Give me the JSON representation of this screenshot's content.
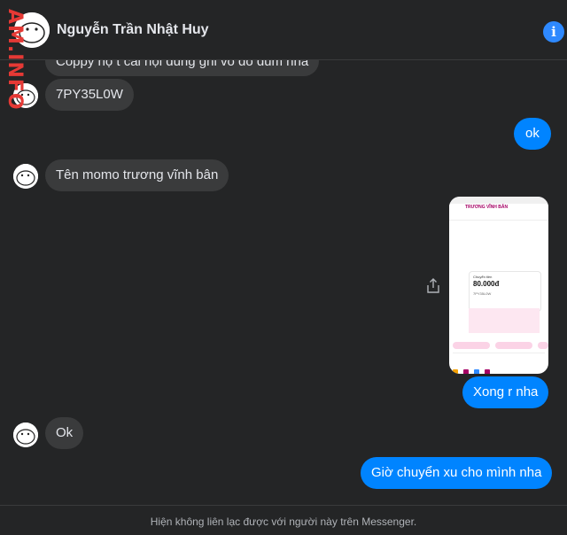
{
  "header": {
    "contact_name": "Nguyễn Trần Nhật Huy",
    "watermark": "AM.INFO"
  },
  "icons": {
    "info": "info-icon",
    "share": "share-icon",
    "avatar": "doodle-avatar-icon"
  },
  "colors": {
    "outgoing_bubble": "#0084ff",
    "incoming_bubble": "#3a3b3c",
    "background": "#242526",
    "info_button": "#2e89ff",
    "watermark": "#e53935"
  },
  "messages": [
    {
      "direction": "in",
      "text": "Coppy họ t cái nội dung ghi vô đó dùm nha"
    },
    {
      "direction": "in",
      "text": "7PY35L0W"
    },
    {
      "direction": "out",
      "text": "ok"
    },
    {
      "direction": "in",
      "text": "Tên momo trương vĩnh bân"
    },
    {
      "direction": "out",
      "type": "image"
    },
    {
      "direction": "out",
      "text": "Xong r nha"
    },
    {
      "direction": "in",
      "text": "Ok"
    },
    {
      "direction": "out",
      "text": "Giờ chuyển xu cho mình nha"
    }
  ],
  "attachment": {
    "name": "TRƯƠNG VĨNH BÂN",
    "label": "Chuyển tiền",
    "amount": "80.000đ",
    "code": "7PY35L0W"
  },
  "footer": {
    "notice": "Hiện không liên lạc được với người này trên Messenger."
  }
}
